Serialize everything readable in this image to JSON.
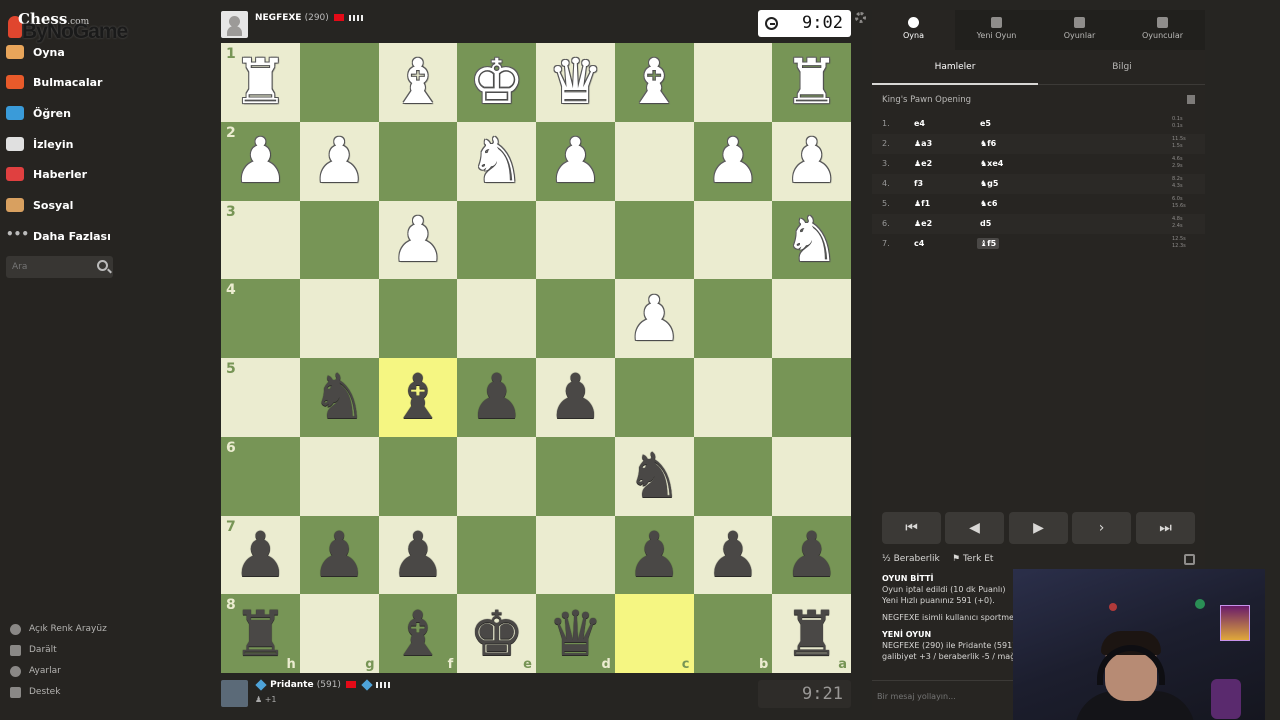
{
  "watermark": {
    "site": "Chess",
    "site_suffix": ".com",
    "channel": "ByNoGame"
  },
  "sidebar": {
    "items": [
      {
        "label": "Oyna",
        "color": "#e8a55a"
      },
      {
        "label": "Bulmacalar",
        "color": "#e85a2a"
      },
      {
        "label": "Öğren",
        "color": "#3a9bd9"
      },
      {
        "label": "İzleyin",
        "color": "#e0e0e0"
      },
      {
        "label": "Haberler",
        "color": "#e04040"
      },
      {
        "label": "Sosyal",
        "color": "#d8a060"
      },
      {
        "label": "Daha Fazlası",
        "color": "#bbbbbb"
      }
    ],
    "search_placeholder": "Ara",
    "bottom": [
      {
        "label": "Açık Renk Arayüz"
      },
      {
        "label": "Darält"
      },
      {
        "label": "Ayarlar"
      },
      {
        "label": "Destek"
      }
    ]
  },
  "top_player": {
    "name": "NEGFEXE",
    "rating": "(290)",
    "clock": "9:02"
  },
  "bottom_player": {
    "name": "Pridante",
    "rating": "(591)",
    "sub": "+1",
    "clock": "9:21"
  },
  "board": {
    "ranks": [
      "1",
      "2",
      "3",
      "4",
      "5",
      "6",
      "7",
      "8"
    ],
    "files": [
      "h",
      "g",
      "f",
      "e",
      "d",
      "c",
      "b",
      "a"
    ],
    "highlight": [
      [
        4,
        2
      ],
      [
        7,
        5
      ]
    ],
    "pieces": [
      [
        "wR",
        "",
        "wB",
        "wK",
        "wQ",
        "wB",
        "",
        "wR"
      ],
      [
        "wP",
        "wP",
        "",
        "wN",
        "wP",
        "",
        "wP",
        "wP"
      ],
      [
        "",
        "",
        "wP",
        "",
        "",
        "",
        "",
        "wN"
      ],
      [
        "",
        "",
        "",
        "",
        "",
        "wP",
        "",
        ""
      ],
      [
        "",
        "bN",
        "bB",
        "bP",
        "bP",
        "",
        "",
        ""
      ],
      [
        "",
        "",
        "",
        "",
        "",
        "bN",
        "",
        ""
      ],
      [
        "bP",
        "bP",
        "bP",
        "",
        "",
        "bP",
        "bP",
        "bP"
      ],
      [
        "bR",
        "",
        "bB",
        "bK",
        "bQ",
        "",
        "",
        "bR"
      ]
    ]
  },
  "panel": {
    "tabs": [
      {
        "label": "Oyna"
      },
      {
        "label": "Yeni Oyun"
      },
      {
        "label": "Oyunlar"
      },
      {
        "label": "Oyuncular"
      }
    ],
    "subtabs": [
      {
        "label": "Hamleler"
      },
      {
        "label": "Bilgi"
      }
    ],
    "opening": "King's Pawn Opening",
    "moves": [
      {
        "num": "1.",
        "white": "e4",
        "black": "e5",
        "t1": "0.1s",
        "t2": "0.1s"
      },
      {
        "num": "2.",
        "white": "♟a3",
        "black": "♞f6",
        "t1": "11.5s",
        "t2": "1.5s"
      },
      {
        "num": "3.",
        "white": "♟e2",
        "black": "♞xe4",
        "t1": "4.6s",
        "t2": "2.9s"
      },
      {
        "num": "4.",
        "white": "f3",
        "black": "♞g5",
        "t1": "8.2s",
        "t2": "4.3s"
      },
      {
        "num": "5.",
        "white": "♟f1",
        "black": "♞c6",
        "t1": "6.0s",
        "t2": "15.6s"
      },
      {
        "num": "6.",
        "white": "♟e2",
        "black": "d5",
        "t1": "4.8s",
        "t2": "2.4s"
      },
      {
        "num": "7.",
        "white": "c4",
        "black": "♝f5",
        "t1": "12.5s",
        "t2": "12.3s"
      }
    ],
    "nav": [
      "⏮",
      "◀",
      "▶",
      "▶",
      "⏭"
    ],
    "draw_label": "Beraberlik",
    "resign_label": "Terk Et",
    "chat": {
      "l1": "OYUN BİTTİ",
      "l2": "Oyun iptal edildi (10 dk Puanlı)",
      "l3": "Yeni Hızlı puanınız 591 (+0).",
      "l4": "NEGFEXE isimli kullanıcı sportmen",
      "l5": "YENİ OYUN",
      "l6": "NEGFEXE (290) ile Pridante (591)",
      "l7": "galibiyet +3 / beraberlik -5 / mağl"
    },
    "chat_placeholder": "Bir mesaj yollayın..."
  }
}
